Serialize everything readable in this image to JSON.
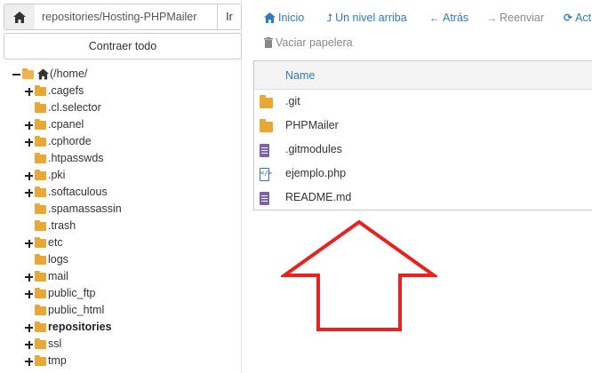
{
  "pathbar": {
    "path_value": "repositories/Hosting-PHPMailer",
    "go_label": "Ir",
    "home_icon": "home-icon"
  },
  "collapse_label": "Contraer todo",
  "tree": {
    "root_label": "(/home/",
    "items": [
      {
        "label": ".cagefs",
        "expandable": true
      },
      {
        "label": ".cl.selector",
        "expandable": false
      },
      {
        "label": ".cpanel",
        "expandable": true
      },
      {
        "label": ".cphorde",
        "expandable": true
      },
      {
        "label": ".htpasswds",
        "expandable": false
      },
      {
        "label": ".pki",
        "expandable": true
      },
      {
        "label": ".softaculous",
        "expandable": true
      },
      {
        "label": ".spamassassin",
        "expandable": false
      },
      {
        "label": ".trash",
        "expandable": false
      },
      {
        "label": "etc",
        "expandable": true
      },
      {
        "label": "logs",
        "expandable": false
      },
      {
        "label": "mail",
        "expandable": true
      },
      {
        "label": "public_ftp",
        "expandable": true
      },
      {
        "label": "public_html",
        "expandable": false
      },
      {
        "label": "repositories",
        "expandable": true,
        "bold": true
      },
      {
        "label": "ssl",
        "expandable": true
      },
      {
        "label": "tmp",
        "expandable": true
      }
    ]
  },
  "toolbar": {
    "home_label": "Inicio",
    "up_label": "Un nivel arriba",
    "back_label": "Atrás",
    "forward_label": "Reenviar",
    "reload_label": "Act",
    "trash_label": "Vaciar papelera"
  },
  "table": {
    "col_name": "Name",
    "files": [
      {
        "name": ".git",
        "type": "folder"
      },
      {
        "name": "PHPMailer",
        "type": "folder"
      },
      {
        "name": ".gitmodules",
        "type": "doc"
      },
      {
        "name": "ejemplo.php",
        "type": "code"
      },
      {
        "name": "README.md",
        "type": "doc"
      }
    ]
  },
  "colors": {
    "link": "#337ab7",
    "folder": "#e8a838",
    "doc": "#7c62a8",
    "annotation_arrow": "#e52421"
  }
}
